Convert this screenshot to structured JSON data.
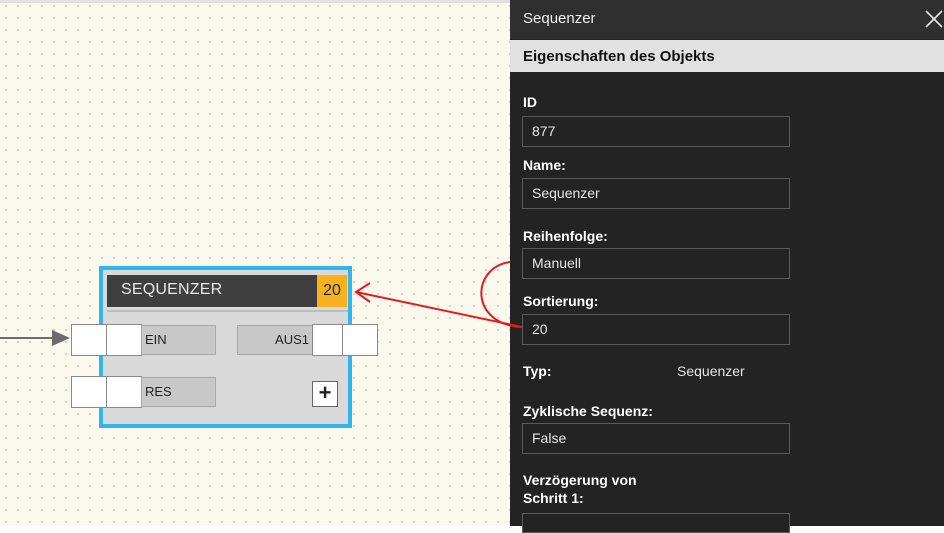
{
  "block": {
    "title": "SEQUENZER",
    "badge": "20",
    "inputs": [
      "EIN",
      "RES"
    ],
    "outputs": [
      "AUS1"
    ],
    "add_symbol": "+"
  },
  "panel": {
    "title": "Sequenzer",
    "subheader": "Eigenschaften des Objekts",
    "fields": {
      "id_label": "ID",
      "id_value": "877",
      "name_label": "Name:",
      "name_value": "Sequenzer",
      "order_label": "Reihenfolge:",
      "order_value": "Manuell",
      "sort_label": "Sortierung:",
      "sort_value": "20",
      "type_label": "Typ:",
      "type_value": "Sequenzer",
      "cyclic_label": "Zyklische Sequenz:",
      "cyclic_value": "False",
      "delay_label_line1": "Verzögerung von",
      "delay_label_line2": "Schritt 1:"
    }
  },
  "colors": {
    "block_border": "#2fb5ef",
    "badge": "#f5b21d",
    "annotation_arrow": "#e21b1b",
    "panel_bg": "#232323"
  },
  "icons": [
    "close-icon",
    "add-icon",
    "connection-arrow-icon"
  ]
}
